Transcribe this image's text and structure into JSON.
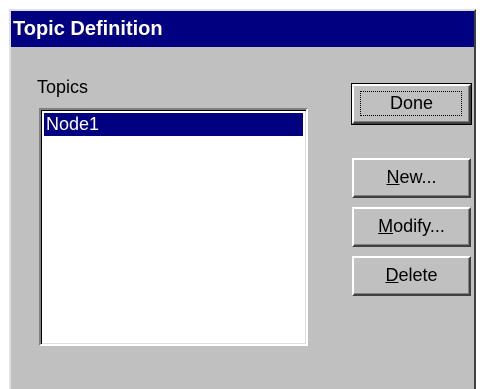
{
  "window": {
    "title": "Topic Definition"
  },
  "topics": {
    "label": "Topics",
    "items": [
      "Node1"
    ],
    "selected_index": 0
  },
  "buttons": {
    "done": {
      "label": "Done"
    },
    "new": {
      "accel": "N",
      "rest": "ew..."
    },
    "modify": {
      "accel": "M",
      "rest": "odify..."
    },
    "delete": {
      "accel": "D",
      "rest": "elete"
    }
  },
  "colors": {
    "titlebar": "#000080",
    "face": "#c0c0c0",
    "selection": "#000080"
  }
}
